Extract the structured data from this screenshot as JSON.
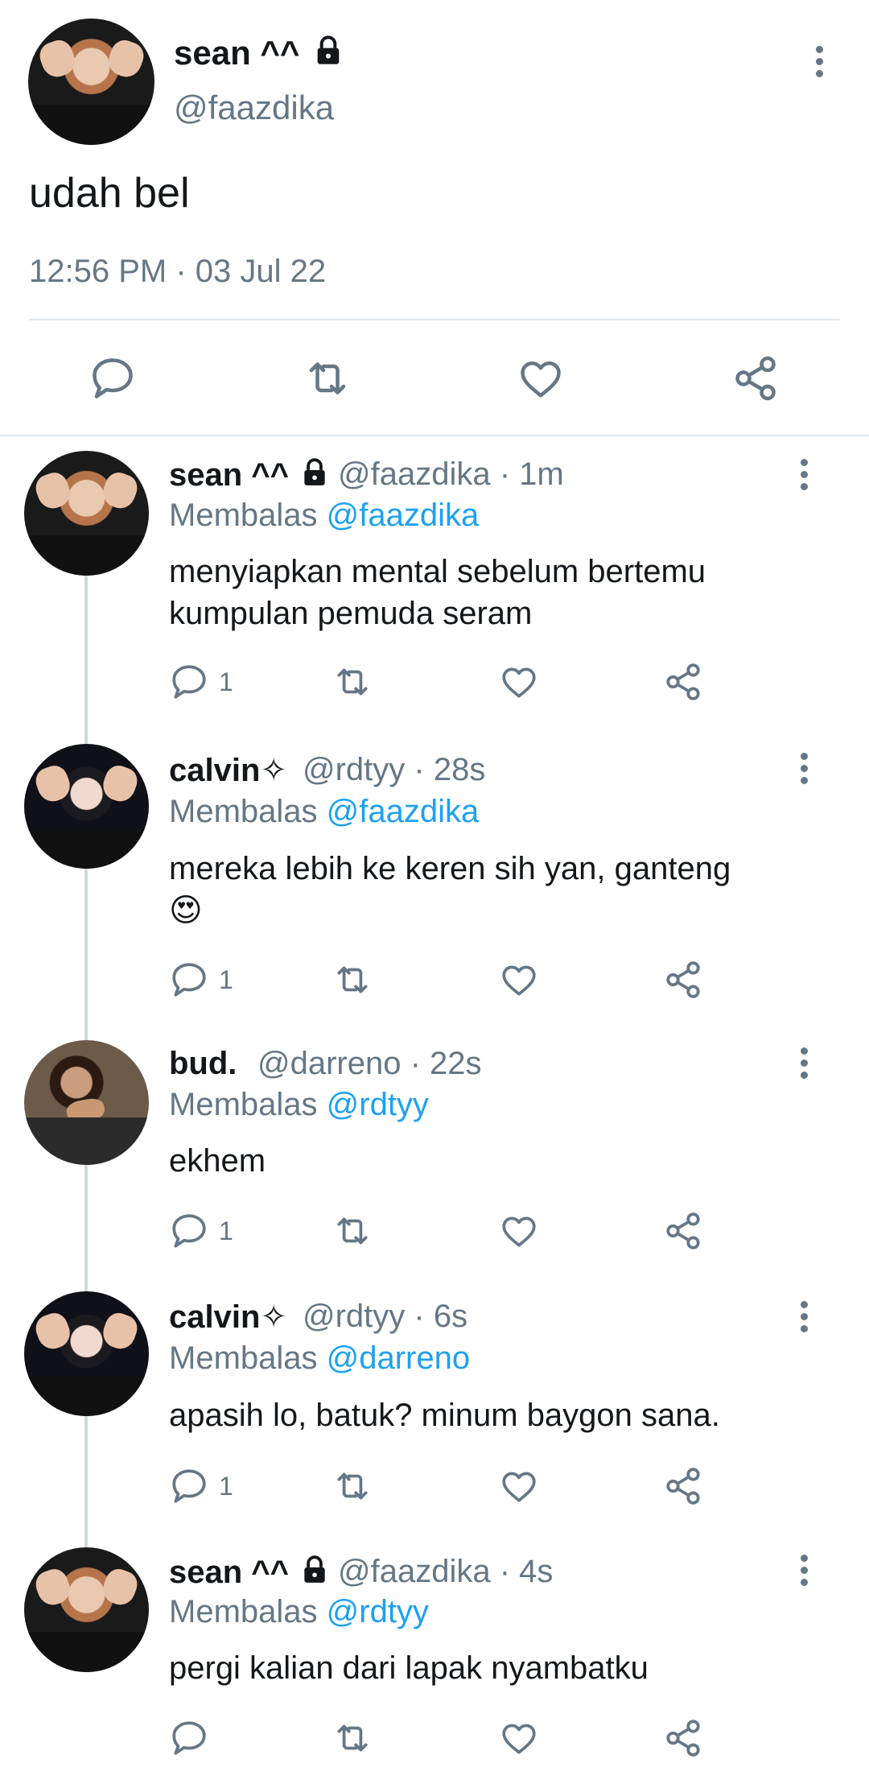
{
  "main_tweet": {
    "name": "sean ^^",
    "handle": "@faazdika",
    "text": "udah bel",
    "timestamp": "12:56 PM · 03 Jul 22",
    "actions": [
      "reply-icon",
      "retweet-icon",
      "like-icon",
      "share-icon"
    ]
  },
  "replies": [
    {
      "name": "sean ^^",
      "handle_time": "@faazdika · 1m",
      "reply_prefix": "Membalas",
      "reply_to": "@faazdika",
      "text": "menyiapkan mental sebelum bertemu kumpulan pemuda seram",
      "reply_count": "1"
    },
    {
      "name": "calvin✧",
      "handle_time": "@rdtyy · 28s",
      "reply_prefix": "Membalas",
      "reply_to": "@faazdika",
      "text": "mereka lebih ke keren sih yan, ganteng",
      "emoji": "😍",
      "reply_count": "1"
    },
    {
      "name": "bud.",
      "handle_time": "@darreno · 22s",
      "reply_prefix": "Membalas",
      "reply_to": "@rdtyy",
      "text": "ekhem",
      "reply_count": "1"
    },
    {
      "name": "calvin✧",
      "handle_time": "@rdtyy · 6s",
      "reply_prefix": "Membalas",
      "reply_to": "@darreno",
      "text": "apasih lo, batuk? minum baygon sana.",
      "reply_count": "1"
    },
    {
      "name": "sean ^^",
      "handle_time": "@faazdika · 4s",
      "reply_prefix": "Membalas",
      "reply_to": "@rdtyy",
      "text": "pergi kalian dari lapak nyambatku",
      "reply_count": ""
    }
  ],
  "colors": {
    "text": "#14171a",
    "muted": "#657786",
    "link": "#1da1f2",
    "divider": "#e1e8ed"
  }
}
